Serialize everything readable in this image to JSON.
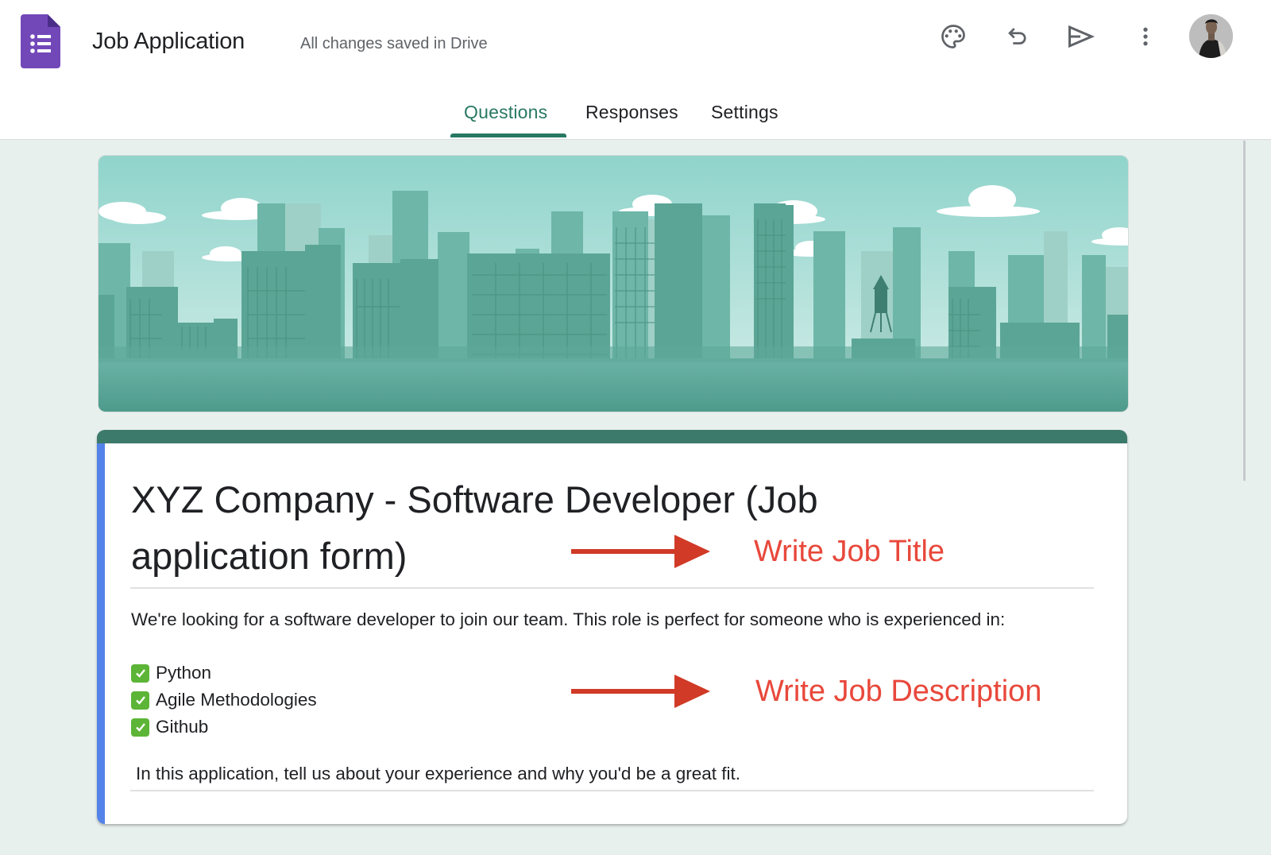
{
  "app": {
    "name": "Google Forms",
    "doc_title": "Job Application",
    "save_status": "All changes saved in Drive"
  },
  "toolbar": {
    "icons": [
      "palette-icon",
      "undo-icon",
      "send-icon",
      "more-vert-icon"
    ],
    "customize_theme_label": "Customize theme",
    "undo_label": "Undo",
    "send_label": "Send",
    "more_label": "More"
  },
  "tabs": [
    {
      "label": "Questions",
      "active": true
    },
    {
      "label": "Responses",
      "active": false
    },
    {
      "label": "Settings",
      "active": false
    }
  ],
  "colors": {
    "accent": "#287863",
    "card_header": "#3c7a6b",
    "focus_bar": "#5382e8",
    "annotation": "#e8483b",
    "background": "#e8f0ee"
  },
  "form": {
    "title": "XYZ Company - Software Developer (Job application form)",
    "description_intro": "We're looking for a software developer to join our team. This role is perfect for someone who is experienced in:",
    "skills": [
      "Python",
      "Agile Methodologies",
      "Github"
    ],
    "description_closing": "In this application, tell us about your experience and why you'd be a great fit."
  },
  "annotations": {
    "title_note": "Write Job Title",
    "description_note": "Write Job Description"
  }
}
